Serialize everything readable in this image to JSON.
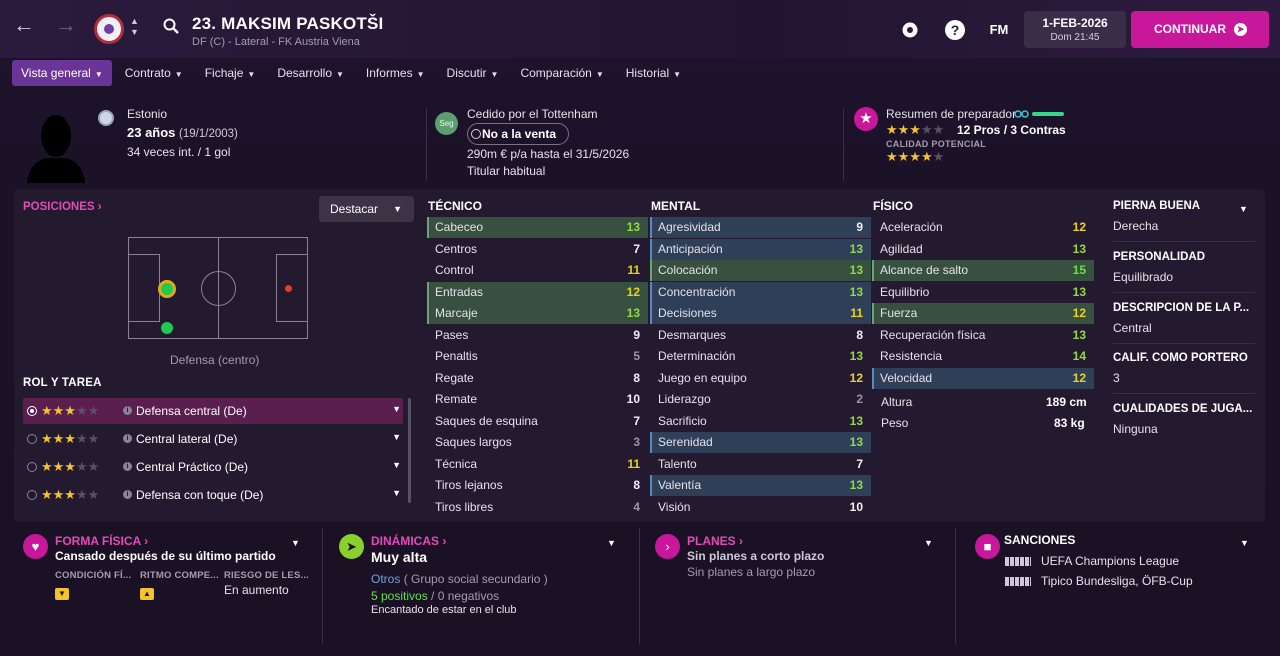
{
  "player": {
    "name": "23. MAKSIM PASKOTŠI",
    "subtitle": "DF (C) - Lateral - FK Austria Viena",
    "nationality": "Estonio",
    "age": "23 años",
    "dob": "(19/1/2003)",
    "caps": "34 veces int. / 1 gol"
  },
  "top": {
    "date": "1-FEB-2026",
    "time": "Dom 21:45",
    "continue": "CONTINUAR",
    "fm": "FM",
    "help": "?"
  },
  "tabs": [
    {
      "label": "Vista general"
    },
    {
      "label": "Contrato"
    },
    {
      "label": "Fichaje"
    },
    {
      "label": "Desarrollo"
    },
    {
      "label": "Informes"
    },
    {
      "label": "Discutir"
    },
    {
      "label": "Comparación"
    },
    {
      "label": "Historial"
    }
  ],
  "loan": {
    "badge": "Seg",
    "title": "Cedido por el Tottenham",
    "status": "No a la venta",
    "wage": "290m € p/a hasta el 31/5/2026",
    "role": "Titular habitual"
  },
  "coach": {
    "title": "Resumen de preparador",
    "pros_cons": "12 Pros / 3 Contras",
    "potential_label": "CALIDAD POTENCIAL",
    "ability_stars": 3,
    "potential_stars": 4
  },
  "positions": {
    "title": "POSICIONES",
    "highlight": "Destacar",
    "position_label": "Defensa (centro)",
    "roles_title": "ROL Y TAREA",
    "roles": [
      {
        "label": "Defensa central (De)",
        "stars": 3
      },
      {
        "label": "Central lateral (De)",
        "stars": 3
      },
      {
        "label": "Central Práctico (De)",
        "stars": 3
      },
      {
        "label": "Defensa con toque (De)",
        "stars": 3
      }
    ]
  },
  "attributes": {
    "tecnico_title": "TÉCNICO",
    "mental_title": "MENTAL",
    "fisico_title": "FÍSICO",
    "tecnico": [
      {
        "name": "Cabeceo",
        "value": 13,
        "hl": "g"
      },
      {
        "name": "Centros",
        "value": 7,
        "hl": ""
      },
      {
        "name": "Control",
        "value": 11,
        "hl": ""
      },
      {
        "name": "Entradas",
        "value": 12,
        "hl": "g"
      },
      {
        "name": "Marcaje",
        "value": 13,
        "hl": "g"
      },
      {
        "name": "Pases",
        "value": 9,
        "hl": ""
      },
      {
        "name": "Penaltis",
        "value": 5,
        "hl": ""
      },
      {
        "name": "Regate",
        "value": 8,
        "hl": ""
      },
      {
        "name": "Remate",
        "value": 10,
        "hl": ""
      },
      {
        "name": "Saques de esquina",
        "value": 7,
        "hl": ""
      },
      {
        "name": "Saques largos",
        "value": 3,
        "hl": ""
      },
      {
        "name": "Técnica",
        "value": 11,
        "hl": ""
      },
      {
        "name": "Tiros lejanos",
        "value": 8,
        "hl": ""
      },
      {
        "name": "Tiros libres",
        "value": 4,
        "hl": ""
      }
    ],
    "mental": [
      {
        "name": "Agresividad",
        "value": 9,
        "hl": "b"
      },
      {
        "name": "Anticipación",
        "value": 13,
        "hl": "b"
      },
      {
        "name": "Colocación",
        "value": 13,
        "hl": "g"
      },
      {
        "name": "Concentración",
        "value": 13,
        "hl": "b"
      },
      {
        "name": "Decisiones",
        "value": 11,
        "hl": "b"
      },
      {
        "name": "Desmarques",
        "value": 8,
        "hl": ""
      },
      {
        "name": "Determinación",
        "value": 13,
        "hl": ""
      },
      {
        "name": "Juego en equipo",
        "value": 12,
        "hl": ""
      },
      {
        "name": "Liderazgo",
        "value": 2,
        "hl": ""
      },
      {
        "name": "Sacrificio",
        "value": 13,
        "hl": ""
      },
      {
        "name": "Serenidad",
        "value": 13,
        "hl": "b"
      },
      {
        "name": "Talento",
        "value": 7,
        "hl": ""
      },
      {
        "name": "Valentía",
        "value": 13,
        "hl": "b"
      },
      {
        "name": "Visión",
        "value": 10,
        "hl": ""
      }
    ],
    "fisico": [
      {
        "name": "Aceleración",
        "value": 12,
        "hl": ""
      },
      {
        "name": "Agilidad",
        "value": 13,
        "hl": ""
      },
      {
        "name": "Alcance de salto",
        "value": 15,
        "hl": "g"
      },
      {
        "name": "Equilibrio",
        "value": 13,
        "hl": ""
      },
      {
        "name": "Fuerza",
        "value": 12,
        "hl": "g"
      },
      {
        "name": "Recuperación física",
        "value": 13,
        "hl": ""
      },
      {
        "name": "Resistencia",
        "value": 14,
        "hl": ""
      },
      {
        "name": "Velocidad",
        "value": 12,
        "hl": "b"
      }
    ],
    "height_label": "Altura",
    "height": "189 cm",
    "weight_label": "Peso",
    "weight": "83 kg"
  },
  "side": [
    {
      "h": "PIERNA BUENA",
      "t": "Derecha"
    },
    {
      "h": "PERSONALIDAD",
      "t": "Equilibrado"
    },
    {
      "h": "DESCRIPCIÓN DE LA P...",
      "t": "Central"
    },
    {
      "h": "CALIF. COMO PORTERO",
      "t": "3"
    },
    {
      "h": "CUALIDADES DE JUGA...",
      "t": "Ninguna"
    }
  ],
  "bottom": {
    "forma": {
      "title": "FORMA FÍSICA",
      "main": "Cansado después de su último partido",
      "c1": "CONDICIÓN FÍ...",
      "c2": "RITMO COMPE...",
      "c3": "RIESGO DE LES...",
      "risk": "En aumento"
    },
    "dinamicas": {
      "title": "DINÁMICAS",
      "main": "Muy alta",
      "group": "Otros",
      "group_desc": "( Grupo social secundario )",
      "pos": "5 positivos",
      "sep": "/",
      "neg": "0 negativos",
      "note": "Encantado de estar en el club"
    },
    "planes": {
      "title": "PLANES",
      "main": "Sin planes a corto plazo",
      "sub": "Sin planes a largo plazo"
    },
    "sanciones": {
      "title": "SANCIONES",
      "l1": "UEFA Champions League",
      "l2": "Tipico Bundesliga, ÖFB-Cup"
    }
  }
}
